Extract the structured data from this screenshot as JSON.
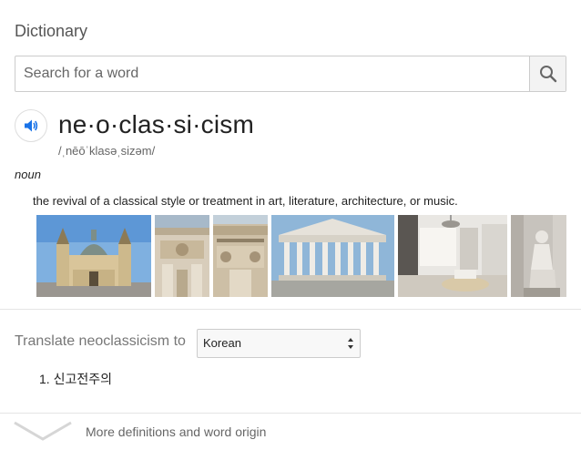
{
  "header": {
    "title": "Dictionary"
  },
  "search": {
    "placeholder": "Search for a word",
    "value": ""
  },
  "entry": {
    "headword": "ne·o·clas·si·cism",
    "pronunciation": "/ˌnēōˈklasəˌsizəm/",
    "part_of_speech": "noun",
    "definition": "the revival of a classical style or treatment in art, literature, architecture, or music."
  },
  "images": [
    {
      "name": "basilica-image"
    },
    {
      "name": "facade-detail-image"
    },
    {
      "name": "column-capital-image"
    },
    {
      "name": "supreme-court-image"
    },
    {
      "name": "interior-room-image"
    },
    {
      "name": "statue-image"
    }
  ],
  "translate": {
    "label": "Translate neoclassicism to",
    "selected_language": "Korean",
    "results": [
      "1. 신고전주의"
    ]
  },
  "footer": {
    "more_label": "More definitions and word origin"
  },
  "colors": {
    "accent": "#1a73e8",
    "muted": "#777777"
  },
  "icons": {
    "search": "search-icon",
    "speaker": "speaker-icon",
    "chevron": "chevron-down-icon",
    "select": "select-arrows-icon"
  }
}
